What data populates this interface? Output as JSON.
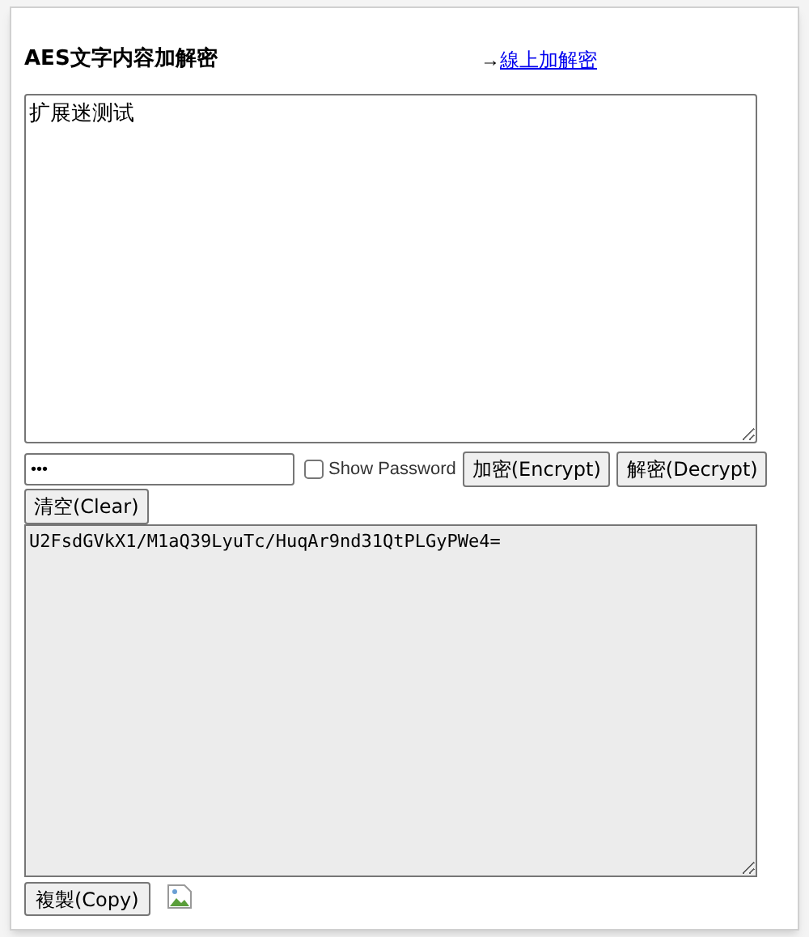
{
  "title": "AES文字内容加解密",
  "online_link": {
    "arrow": "→",
    "label": "線上加解密"
  },
  "input_text": "扩展迷测试",
  "password": {
    "value": "•••"
  },
  "show_password": {
    "label": "Show Password",
    "checked": false
  },
  "buttons": [
    {
      "kind": "encrypt",
      "label": "加密(Encrypt)"
    },
    {
      "kind": "decrypt",
      "label": "解密(Decrypt)"
    },
    {
      "kind": "clear",
      "label": "清空(Clear)"
    }
  ],
  "output_text": "U2FsdGVkX1/M1aQ39LyuTc/HuqAr9nd31QtPLGyPWe4=",
  "copy_button": {
    "label": "複製(Copy)"
  }
}
